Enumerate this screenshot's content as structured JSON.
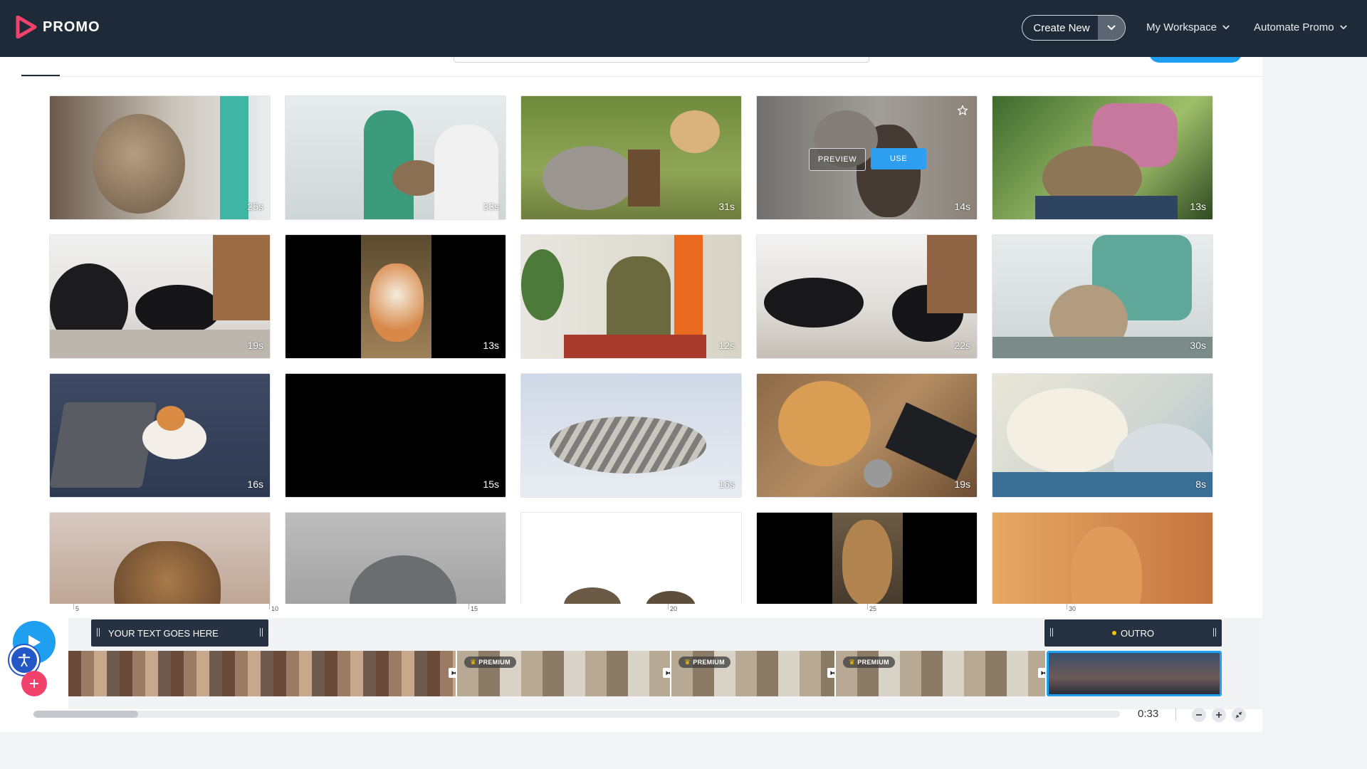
{
  "header": {
    "logo_text": "PROMO",
    "create_new_label": "Create New",
    "workspace_label": "My Workspace",
    "automate_label": "Automate Promo"
  },
  "library": {
    "items": [
      {
        "duration": "25s",
        "scene": "cat-on-shoulder"
      },
      {
        "duration": "33s",
        "scene": "vet-clinic"
      },
      {
        "duration": "31s",
        "scene": "cats-in-garden"
      },
      {
        "duration": "14s",
        "scene": "woman-with-cat",
        "hovered": true
      },
      {
        "duration": "13s",
        "scene": "cat-on-lap"
      },
      {
        "duration": "19s",
        "scene": "black-cats-snow"
      },
      {
        "duration": "13s",
        "scene": "ginger-cat-portrait"
      },
      {
        "duration": "12s",
        "scene": "woman-hugging-cat"
      },
      {
        "duration": "22s",
        "scene": "two-black-cats"
      },
      {
        "duration": "30s",
        "scene": "vet-petting-cat"
      },
      {
        "duration": "16s",
        "scene": "cat-with-laptop"
      },
      {
        "duration": "15s",
        "scene": "black-clip"
      },
      {
        "duration": "16s",
        "scene": "tabby-kitten"
      },
      {
        "duration": "19s",
        "scene": "cat-on-desk"
      },
      {
        "duration": "8s",
        "scene": "fluffy-white-cats"
      },
      {
        "duration": "",
        "scene": "cat-outdoors"
      },
      {
        "duration": "",
        "scene": "grey-cat"
      },
      {
        "duration": "",
        "scene": "cats-white-bg"
      },
      {
        "duration": "",
        "scene": "cat-looking-up"
      },
      {
        "duration": "",
        "scene": "ginger-cat-indoors"
      }
    ],
    "hover_preview_label": "PREVIEW",
    "hover_use_label": "USE"
  },
  "timeline": {
    "ruler_ticks": [
      "5",
      "10",
      "15",
      "20",
      "25",
      "30"
    ],
    "text_layer_label": "YOUR TEXT GOES HERE",
    "outro_label": "OUTRO",
    "premium_label": "PREMIUM",
    "total_time": "0:33"
  },
  "colors": {
    "header_bg": "#1f2a38",
    "accent_blue": "#1f9ff0",
    "add_pink": "#f2416b",
    "premium_gold": "#f5c400"
  }
}
